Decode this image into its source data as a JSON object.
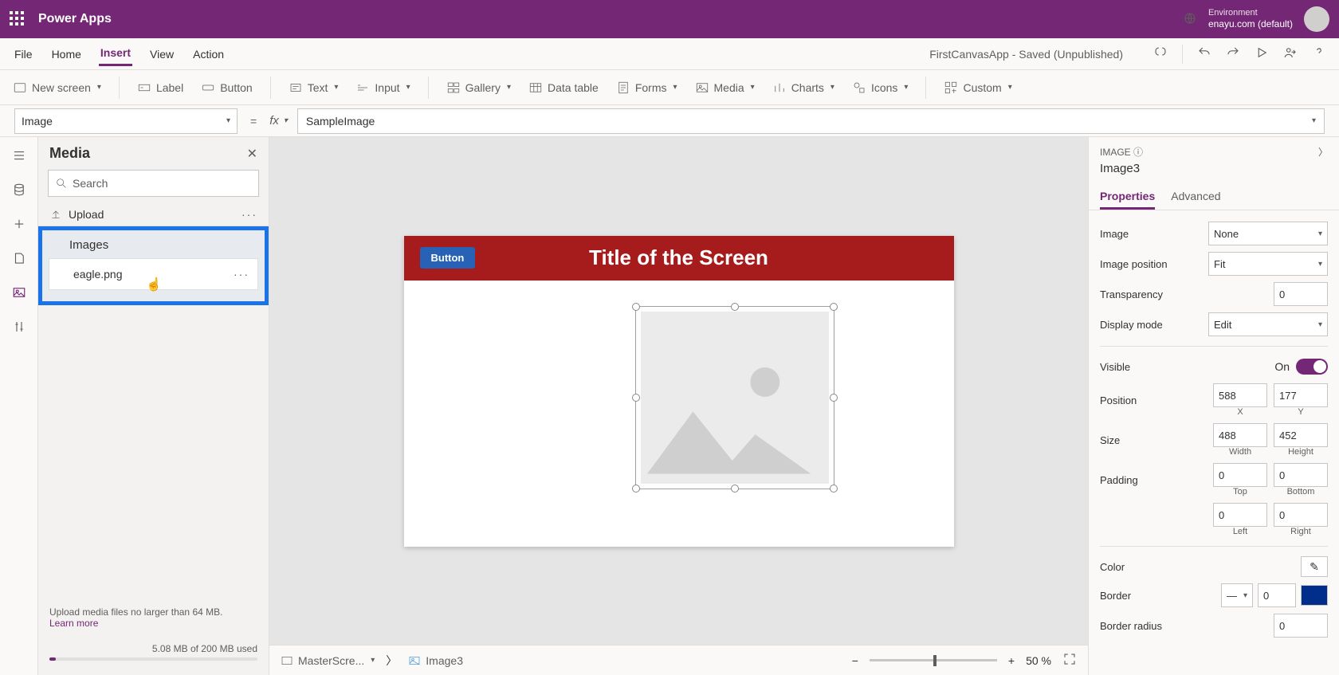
{
  "header": {
    "app_name": "Power Apps",
    "env_label": "Environment",
    "env_value": "enayu.com (default)"
  },
  "menu": {
    "items": [
      "File",
      "Home",
      "Insert",
      "View",
      "Action"
    ],
    "active": "Insert",
    "doc_status": "FirstCanvasApp - Saved (Unpublished)"
  },
  "ribbon": {
    "new_screen": "New screen",
    "label": "Label",
    "button": "Button",
    "text": "Text",
    "input": "Input",
    "gallery": "Gallery",
    "data_table": "Data table",
    "forms": "Forms",
    "media": "Media",
    "charts": "Charts",
    "icons": "Icons",
    "custom": "Custom"
  },
  "formula": {
    "property": "Image",
    "value": "SampleImage"
  },
  "media_panel": {
    "title": "Media",
    "search_placeholder": "Search",
    "upload": "Upload",
    "section": "Images",
    "item": "eagle.png",
    "footer_text": "Upload media files no larger than 64 MB.",
    "learn_more": "Learn more",
    "usage": "5.08 MB of 200 MB used"
  },
  "canvas": {
    "title": "Title of the Screen",
    "button_label": "Button"
  },
  "status_bar": {
    "screen": "MasterScre...",
    "control": "Image3",
    "zoom": "50  %"
  },
  "props": {
    "type_label": "IMAGE",
    "control_name": "Image3",
    "tabs": [
      "Properties",
      "Advanced"
    ],
    "image": {
      "label": "Image",
      "value": "None"
    },
    "image_position": {
      "label": "Image position",
      "value": "Fit"
    },
    "transparency": {
      "label": "Transparency",
      "value": "0"
    },
    "display_mode": {
      "label": "Display mode",
      "value": "Edit"
    },
    "visible": {
      "label": "Visible",
      "value": "On"
    },
    "position": {
      "label": "Position",
      "x": "588",
      "y": "177",
      "xl": "X",
      "yl": "Y"
    },
    "size": {
      "label": "Size",
      "w": "488",
      "h": "452",
      "wl": "Width",
      "hl": "Height"
    },
    "padding": {
      "label": "Padding",
      "t": "0",
      "b": "0",
      "l": "0",
      "r": "0",
      "tl": "Top",
      "bl": "Bottom",
      "ll": "Left",
      "rl": "Right"
    },
    "color": {
      "label": "Color"
    },
    "border": {
      "label": "Border",
      "value": "0"
    },
    "border_radius": {
      "label": "Border radius",
      "value": "0"
    }
  }
}
